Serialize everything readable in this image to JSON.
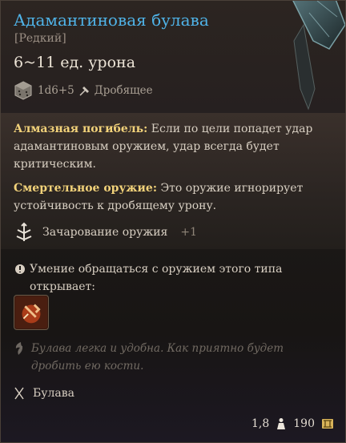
{
  "item": {
    "name": "Адамантиновая булава",
    "rarity": "[Редкий]",
    "damage": "6~11 ед. урона",
    "dice": "1d6+5",
    "damage_type": "Дробящее"
  },
  "properties": [
    {
      "name": "Алмазная погибель:",
      "text": " Если по цели попадет удар адамантиновым оружием, удар всегда будет критическим."
    },
    {
      "name": "Смертельное оружие:",
      "text": " Это оружие игнорирует устойчивость к дробящему урону."
    }
  ],
  "enchantment": {
    "label": "Зачарование оружия",
    "bonus": "+1"
  },
  "proficiency": {
    "text": "Умение обращаться с оружием этого типа открывает:"
  },
  "flavor": "Булава легка и удобна. Как приятно будет дробить ею кости.",
  "weapon_type": "Булава",
  "footer": {
    "weight": "1,8",
    "value": "190"
  },
  "colors": {
    "title": "#4fb3e8",
    "property_name": "#f2d27a",
    "coin": "#d9b45a"
  },
  "icons": [
    "dice-icon",
    "hammer-icon",
    "enchant-icon",
    "proficiency-icon",
    "action-icon",
    "flavor-icon",
    "mace-icon",
    "weight-icon",
    "coin-icon"
  ]
}
